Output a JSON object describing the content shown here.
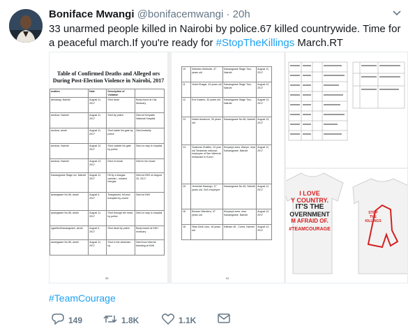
{
  "tweet": {
    "name": "Boniface Mwangi",
    "handle": "@bonifacemwangi",
    "separator": "·",
    "time": "20h",
    "text_part1": "33 unarmed people killed in Nairobi by police.67 killed countrywide. Time for a peaceful march.If you're ready for ",
    "hashtag_inline": "#StopTheKillings",
    "text_part2": " March.RT",
    "hashtag": "#TeamCourage"
  },
  "actions": {
    "replies": "149",
    "retweets": "1.8K",
    "likes": "1.1K"
  },
  "colors": {
    "link": "#1da1f2",
    "muted": "#657786",
    "text": "#14171a"
  },
  "icons": {
    "reply": "reply-icon",
    "retweet": "retweet-icon",
    "like": "heart-icon",
    "dm": "envelope-icon",
    "more": "chevron-down-icon"
  },
  "doc1": {
    "title": "Table of Confirmed Deaths and Alleged ors During Post-Election Violence in Nairobi, 2017",
    "headers": [
      "ocation",
      "Date",
      "Description of Violation",
      ""
    ],
    "rows": [
      [
        "atindangi, Nairobi",
        "August 11, 2017",
        "Shot dead",
        "Body found at City Mortuary"
      ],
      [
        "amdora, Nairobi",
        "August 11, 2017",
        "Shot by police",
        "Died at Kenyatta National Hospital"
      ],
      [
        "amdora, airobi",
        "August 11, 2017",
        "Shot inside his gate by police",
        "Died instantly"
      ],
      [
        "amdora, Nairobi",
        "August 12, 2017",
        "Shot outside his gate by police",
        "Died on way to hospital"
      ],
      [
        "amdora, Nairobi",
        "August 12, 2017",
        "Died of shock",
        "Died in his house"
      ],
      [
        "Kawangware Stage wo, Nairobi",
        "August 11, 2017",
        "Hit by a teargas canister - inhaled teargas",
        "Died at KNH on August 20, 2017"
      ],
      [
        "awangware No.56, airobi",
        "August 9, 2017",
        "Teargassed, fell and trampled by crowd",
        "Died at KNH"
      ],
      [
        "awangware No.56, airobi",
        "August 11, 2017",
        "Shot through the head by police",
        "Died on way to hospital"
      ],
      [
        "ngaethu/Kawangware, airobi",
        "August 9, 2017",
        "Shot dead by police",
        "Body traced at KNH mortuary"
      ],
      [
        "awangware No.56, airobi",
        "August 11, 2017",
        "Shot in the abdomen by",
        "Died from internal bleeding at KNH"
      ]
    ],
    "page_number": "30"
  },
  "doc2": {
    "rows": [
      [
        "10",
        "Zebedeo Mokhoth, 47 years old",
        "Kawangware Stage Two, Nairobi",
        "August 11, 2017"
      ],
      [
        "11",
        "Violet Khagai, 43 years old",
        "Kawangware Stage Two, Nairobi",
        "August 12, 2017"
      ],
      [
        "12",
        "Eric Kwamu, 30 years old",
        "Kawangware Stage Two, Nairobi",
        "August 12, 2017"
      ],
      [
        "13",
        "Nelvin Amakove, 30 years old",
        "Kawangware No.56, Nairobi",
        "August 13, 2017"
      ],
      [
        "14",
        "Sulaiman Khalibu, 24 year old Tanzanian national, employee of San Valencia restaurant in Kuren",
        "Kinyanjui area, Wanye, near Kawangware, Nairobi",
        "August 11, 2017"
      ],
      [
        "15",
        "Jeremiah Mwangu, 47 years old, G4S employee",
        "Kawangware No.46, Nairobi",
        "August 11, 2017"
      ],
      [
        "16",
        "Bonaxo Wandera, 47 years old",
        "Kinyanjui area, near Kawangware, Nairobi",
        "August 12, 2017"
      ],
      [
        "18",
        "Silas Dedi Lubo, 18 years old",
        "Kathani 46 - Corea, Nairobi",
        "August 12, 2017"
      ]
    ],
    "page_number": "31"
  },
  "shirt1": {
    "line1": "I LOVE",
    "line2": "Y COUNTRY.",
    "line3": "IT'S THE",
    "line4": "OVERNMENT",
    "line5": "M AFRAID OF.",
    "tag": "#TEAMCOURAGE"
  },
  "shirt2": {
    "line1": "STOP",
    "line2": "THE",
    "line3": "KILLINGS"
  }
}
